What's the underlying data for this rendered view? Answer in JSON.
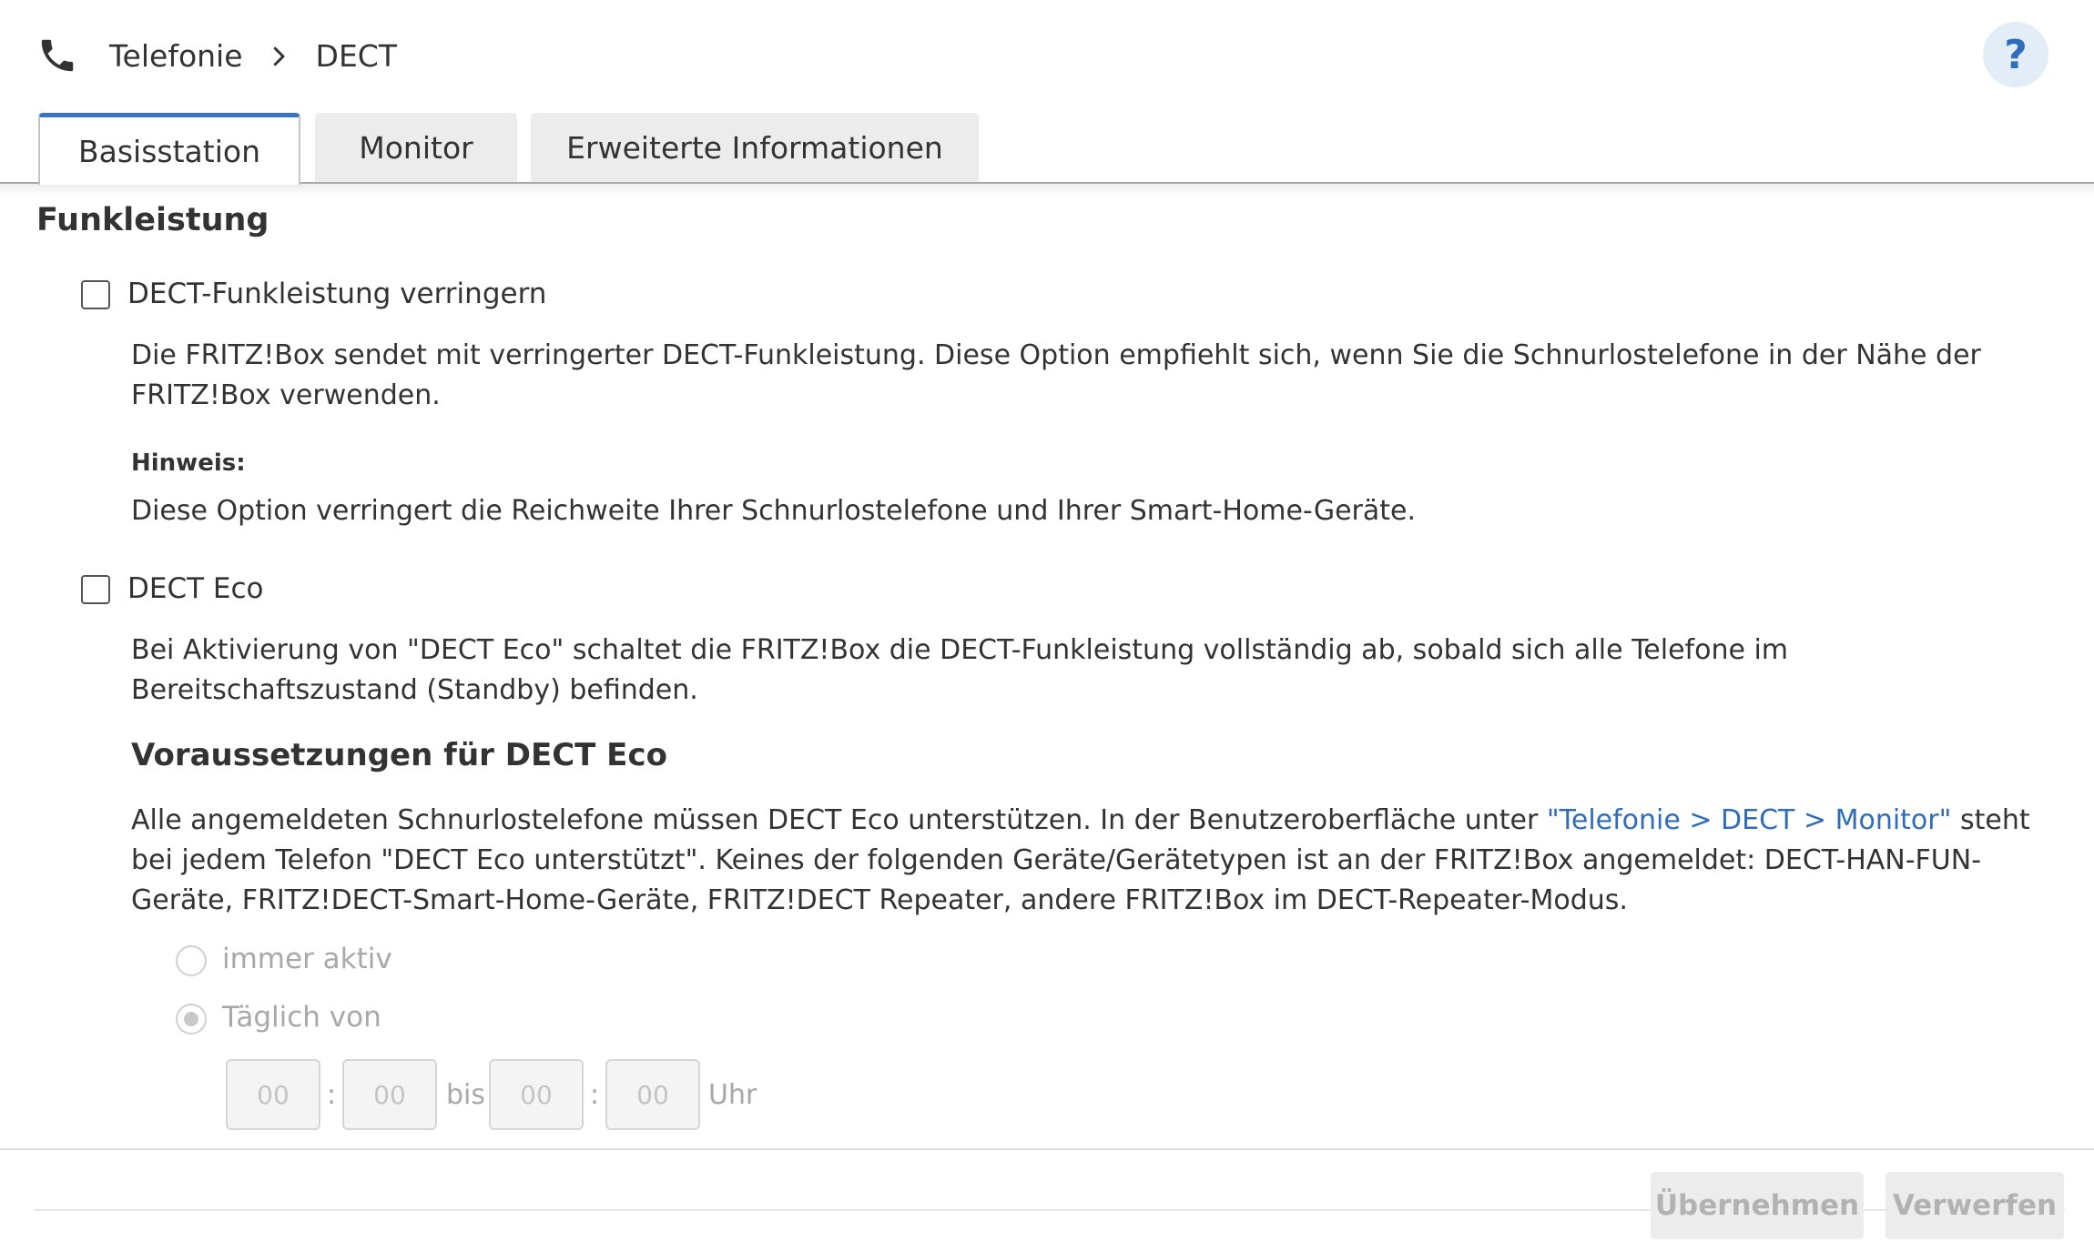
{
  "header": {
    "icon": "phone-icon",
    "breadcrumb": [
      "Telefonie",
      "DECT"
    ],
    "help_label": "?"
  },
  "tabs": [
    {
      "label": "Basisstation",
      "active": true
    },
    {
      "label": "Monitor",
      "active": false
    },
    {
      "label": "Erweiterte Informationen",
      "active": false
    }
  ],
  "section": {
    "title": "Funkleistung",
    "option1": {
      "label": "DECT-Funkleistung verringern",
      "checked": false,
      "description": "Die FRITZ!Box sendet mit verringerter DECT-Funkleistung. Diese Option empfiehlt sich, wenn Sie die Schnurlostelefone in der Nähe der FRITZ!Box verwenden.",
      "hint_label": "Hinweis:",
      "hint_text": "Diese Option verringert die Reichweite Ihrer Schnurlostelefone und Ihrer Smart-Home-Geräte."
    },
    "option2": {
      "label": "DECT Eco",
      "checked": false,
      "description": "Bei Aktivierung von \"DECT Eco\" schaltet die FRITZ!Box die DECT-Funkleistung vollständig ab, sobald sich alle Telefone im Bereitschaftszustand (Standby) befinden.",
      "prereq_title": "Voraussetzungen für DECT Eco",
      "prereq_text_1": "Alle angemeldeten Schnurlostelefone müssen DECT Eco unterstützen. In der Benutzeroberfläche unter ",
      "prereq_link": "\"Telefonie > DECT > Monitor\"",
      "prereq_text_2": " steht bei jedem Telefon \"DECT Eco unterstützt\". Keines der folgenden Geräte/Gerätetypen ist an der FRITZ!Box angemeldet: DECT-HAN-FUN-Geräte, FRITZ!DECT-Smart-Home-Geräte, FRITZ!DECT Repeater, andere FRITZ!Box im DECT-Repeater-Modus."
    },
    "schedule": {
      "radio_always": "immer aktiv",
      "radio_daily": "Täglich von",
      "selected": "daily",
      "from_hour_placeholder": "00",
      "from_minute_placeholder": "00",
      "colon": ":",
      "to_label": "bis",
      "to_hour_placeholder": "00",
      "to_minute_placeholder": "00",
      "unit": "Uhr"
    }
  },
  "footer": {
    "apply_label": "Übernehmen",
    "discard_label": "Verwerfen"
  },
  "colors": {
    "accent": "#2f6dbc",
    "tab_active_border": "#3a73c4",
    "help_bg": "#e3edf8",
    "disabled_text": "#b2b2b2"
  }
}
